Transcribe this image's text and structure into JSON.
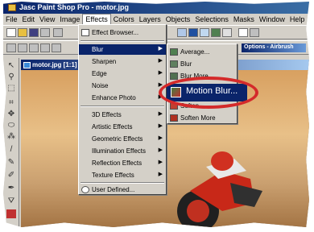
{
  "window": {
    "title": "Jasc Paint Shop Pro - motor.jpg"
  },
  "menubar": [
    "File",
    "Edit",
    "View",
    "Image",
    "Effects",
    "Colors",
    "Layers",
    "Objects",
    "Selections",
    "Masks",
    "Window",
    "Help"
  ],
  "document": {
    "title": "motor.jpg [1:1]",
    "panel_title": "Options - Airbrush"
  },
  "effects_menu": {
    "items": [
      "Effect Browser...",
      "Blur",
      "Sharpen",
      "Edge",
      "Noise",
      "Enhance Photo",
      "3D Effects",
      "Artistic Effects",
      "Geometric Effects",
      "Illumination Effects",
      "Reflection Effects",
      "Texture Effects",
      "User Defined..."
    ]
  },
  "blur_menu": {
    "items": [
      "Average...",
      "Blur",
      "Blur More",
      "Motion Blur...",
      "Soften",
      "Soften More"
    ]
  },
  "colors": {
    "highlight": "#0a246a",
    "callout": "#d42a2a"
  }
}
